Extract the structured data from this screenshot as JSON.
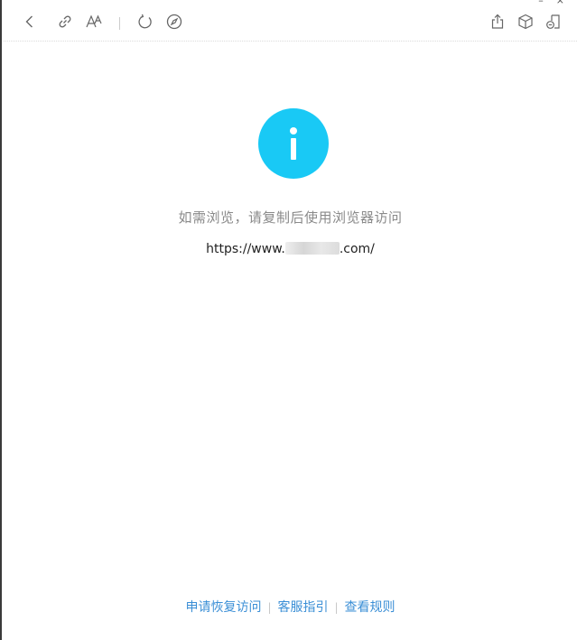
{
  "toolbar": {
    "left_icons": [
      "back-icon",
      "link-icon",
      "font-size-icon",
      "refresh-icon",
      "compass-icon"
    ],
    "right_icons": [
      "share-icon",
      "cube-icon",
      "window-icon"
    ]
  },
  "main": {
    "icon": "info-icon",
    "icon_color": "#19c9f5",
    "message": "如需浏览，请复制后使用浏览器访问",
    "url_prefix": "https://www.",
    "url_suffix": ".com/"
  },
  "footer": {
    "links": [
      "申请恢复访问",
      "客服指引",
      "查看规则"
    ],
    "separator": "|",
    "link_color": "#3b8fd6"
  }
}
